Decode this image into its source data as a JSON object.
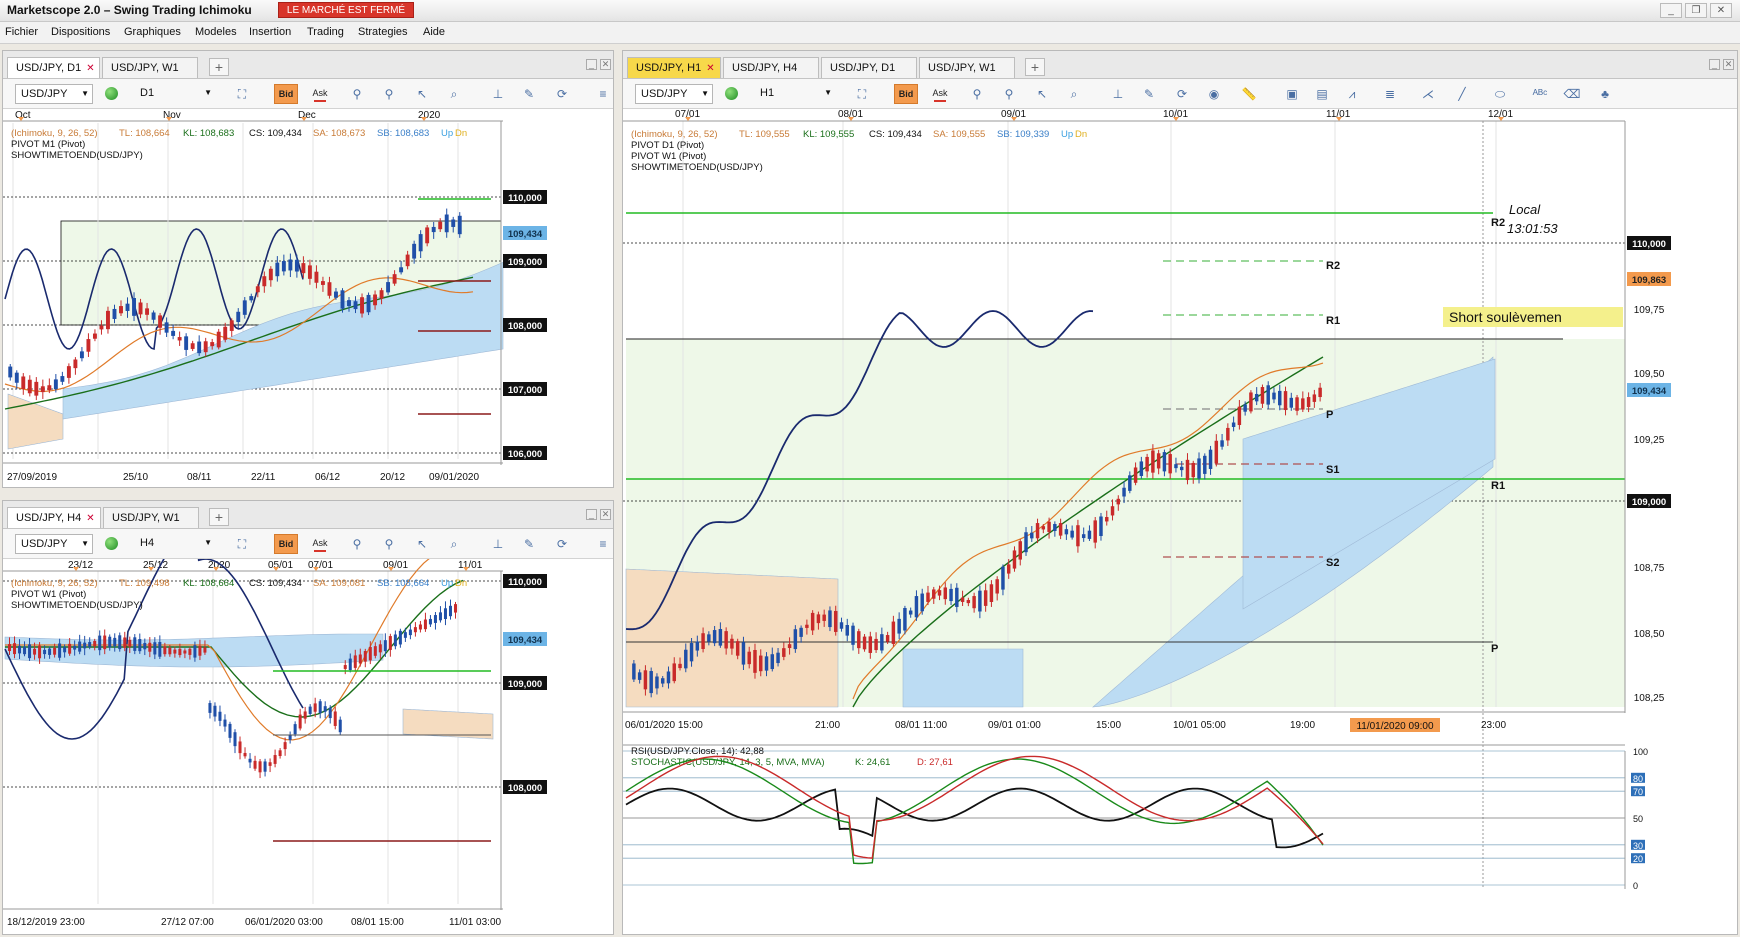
{
  "app": {
    "title": "Marketscope 2.0 – Swing Trading Ichimoku",
    "market_status": "LE MARCHÉ EST FERMÉ",
    "window_controls": [
      "minimize-icon",
      "restore-icon",
      "close-icon"
    ]
  },
  "menu": [
    "Fichier",
    "Dispositions",
    "Graphiques",
    "Modeles",
    "Insertion",
    "Trading",
    "Strategies",
    "Aide"
  ],
  "toolbar_icons": [
    "line-style-icon",
    "crosshair-icon",
    "zoom-icon",
    "cursor-icon",
    "settings-icon"
  ],
  "colors": {
    "bid": "#f39a4d",
    "cloud_blue": "#bcdcf3",
    "cloud_orange": "#f5dcc0",
    "kijun": "#1a6f1a",
    "tenkan": "#e07b2a",
    "chikou": "#1a2a6e",
    "bull": "#1f4fa8",
    "bear": "#c92a2a",
    "pivot_green": "#22bb22",
    "pivot_red": "#8b1a1a",
    "price_tag": "#6cb4e6",
    "alert_tag": "#f39a4d"
  },
  "panels": {
    "d1": {
      "tabs": [
        {
          "label": "USD/JPY, D1",
          "active": true
        },
        {
          "label": "USD/JPY, W1",
          "active": false
        }
      ],
      "symbol": "USD/JPY",
      "timeframe": "D1",
      "bid_label": "Bid",
      "ask_label": "Ask",
      "legend": {
        "ichimoku": "(Ichimoku, 9, 26, 52)",
        "tl": "TL: 108,664",
        "kl": "KL: 108,683",
        "cs": "CS: 109,434",
        "sa": "SA: 108,673",
        "sb": "SB: 108,683",
        "up": "Up",
        "dn": "Dn",
        "pivot": "PIVOT M1 (Pivot)",
        "showtime": "SHOWTIMETOEND(USD/JPY)"
      },
      "top_axis": [
        "Oct",
        "Nov",
        "Dec",
        "2020"
      ],
      "bottom_axis": [
        "27/09/2019",
        "25/10",
        "08/11",
        "22/11",
        "06/12",
        "20/12",
        "09/01/2020"
      ],
      "price_labels": [
        "110,000",
        "109,000",
        "108,000",
        "107,000",
        "106,000"
      ],
      "current_price": "109,434"
    },
    "h4": {
      "tabs": [
        {
          "label": "USD/JPY, H4",
          "active": true
        },
        {
          "label": "USD/JPY, W1",
          "active": false
        }
      ],
      "symbol": "USD/JPY",
      "timeframe": "H4",
      "bid_label": "Bid",
      "ask_label": "Ask",
      "legend": {
        "ichimoku": "(Ichimoku, 9, 26, 52)",
        "tl": "TL: 109,498",
        "kl": "KL: 108,664",
        "cs": "CS: 109,434",
        "sa": "SA: 109,081",
        "sb": "SB: 108,664",
        "up": "Up",
        "dn": "Dn",
        "pivot": "PIVOT W1 (Pivot)",
        "showtime": "SHOWTIMETOEND(USD/JPY)"
      },
      "top_axis": [
        "23/12",
        "25/12",
        "2020",
        "05/01",
        "07/01",
        "09/01",
        "11/01"
      ],
      "bottom_axis": [
        "18/12/2019 23:00",
        "27/12 07:00",
        "06/01/2020 03:00",
        "08/01 15:00",
        "11/01 03:00"
      ],
      "price_labels": [
        "110,000",
        "109,000",
        "108,000"
      ],
      "current_price": "109,434"
    },
    "h1": {
      "tabs": [
        {
          "label": "USD/JPY, H1",
          "active": true
        },
        {
          "label": "USD/JPY, H4",
          "active": false
        },
        {
          "label": "USD/JPY, D1",
          "active": false
        },
        {
          "label": "USD/JPY, W1",
          "active": false
        }
      ],
      "symbol": "USD/JPY",
      "timeframe": "H1",
      "bid_label": "Bid",
      "ask_label": "Ask",
      "legend": {
        "ichimoku": "(Ichimoku, 9, 26, 52)",
        "tl": "TL: 109,555",
        "kl": "KL: 109,555",
        "cs": "CS: 109,434",
        "sa": "SA: 109,555",
        "sb": "SB: 109,339",
        "up": "Up",
        "dn": "Dn",
        "pivot_d1": "PIVOT D1 (Pivot)",
        "pivot_w1": "PIVOT W1 (Pivot)",
        "showtime": "SHOWTIMETOEND(USD/JPY)"
      },
      "top_axis": [
        "07/01",
        "08/01",
        "09/01",
        "10/01",
        "11/01",
        "12/01"
      ],
      "bottom_axis": [
        "06/01/2020 15:00",
        "21:00",
        "08/01 11:00",
        "09/01 01:00",
        "15:00",
        "10/01 05:00",
        "19:00",
        "23:00"
      ],
      "bottom_highlight": "11/01/2020 09:00",
      "price_labels": [
        "110,000",
        "109,75",
        "109,50",
        "109,25",
        "109,000",
        "108,75",
        "108,50",
        "108,25"
      ],
      "current_price": "109,434",
      "alert_price": "109,863",
      "local_label": "Local",
      "local_time": "13:01:53",
      "annotation": "Short soulèvemen",
      "pivot_labels": {
        "r2_w": "R2",
        "r2": "R2",
        "r1": "R1",
        "p": "P",
        "s1": "S1",
        "r1_w": "R1",
        "s2": "S2",
        "p_w": "P"
      },
      "rsi_legend": "RSI(USD/JPY.Close, 14): 42,88",
      "stoch_legend": "STOCHASTIC(USD/JPY, 14, 3, 5, MVA, MVA)",
      "stoch_k": "K: 24,61",
      "stoch_d": "D: 27,61",
      "osc_labels": [
        "100",
        "80",
        "70",
        "50",
        "30",
        "20",
        "0"
      ]
    }
  }
}
